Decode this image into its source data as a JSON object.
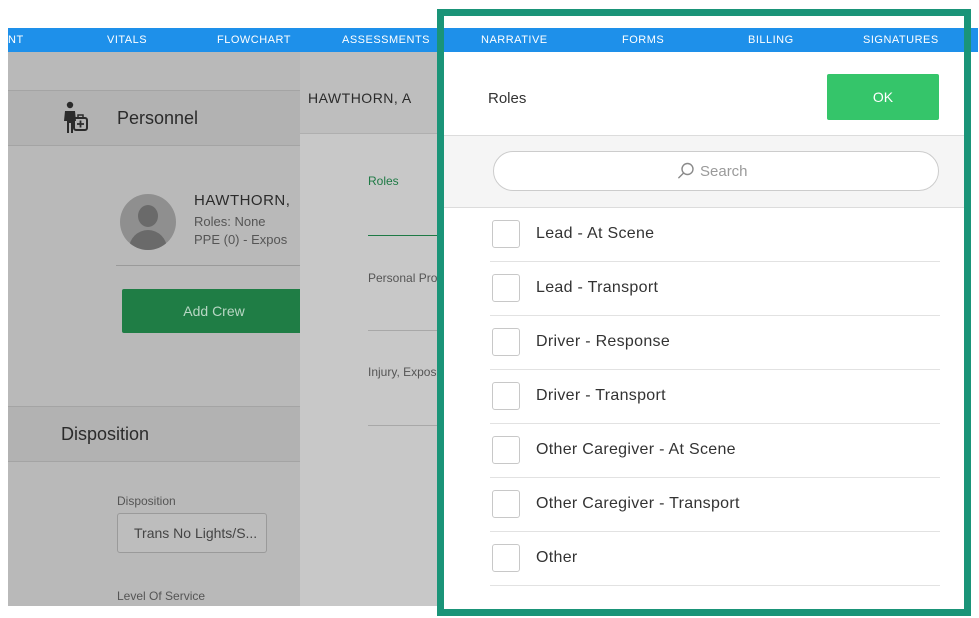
{
  "nav": {
    "tabs": [
      {
        "label": "NT"
      },
      {
        "label": "VITALS"
      },
      {
        "label": "FLOWCHART"
      },
      {
        "label": "ASSESSMENTS"
      },
      {
        "label": "NARRATIVE"
      },
      {
        "label": "FORMS"
      },
      {
        "label": "BILLING"
      },
      {
        "label": "SIGNATURES"
      }
    ]
  },
  "personnel": {
    "title": "Personnel",
    "crew_name": "HAWTHORN,",
    "crew_roles": "Roles: None",
    "crew_ppe": "PPE (0) - Expos",
    "add_crew_label": "Add Crew"
  },
  "disposition": {
    "title": "Disposition",
    "field_label": "Disposition",
    "field_value": "Trans No Lights/S...",
    "level_label": "Level Of Service"
  },
  "detail": {
    "name": "HAWTHORN, A",
    "roles_tab": "Roles",
    "personal_protection": "Personal Prot",
    "injury_exposure": "Injury, Expos"
  },
  "roles_popover": {
    "title": "Roles",
    "ok_label": "OK",
    "search_placeholder": "Search",
    "items": [
      {
        "label": "Lead - At Scene"
      },
      {
        "label": "Lead - Transport"
      },
      {
        "label": "Driver - Response"
      },
      {
        "label": "Driver - Transport"
      },
      {
        "label": "Other Caregiver - At Scene"
      },
      {
        "label": "Other Caregiver - Transport"
      },
      {
        "label": "Other"
      }
    ]
  },
  "colors": {
    "nav_blue": "#1e90ea",
    "ok_green": "#35c56a",
    "frame_teal": "#1a9478",
    "add_crew_green": "#1f7d45"
  }
}
